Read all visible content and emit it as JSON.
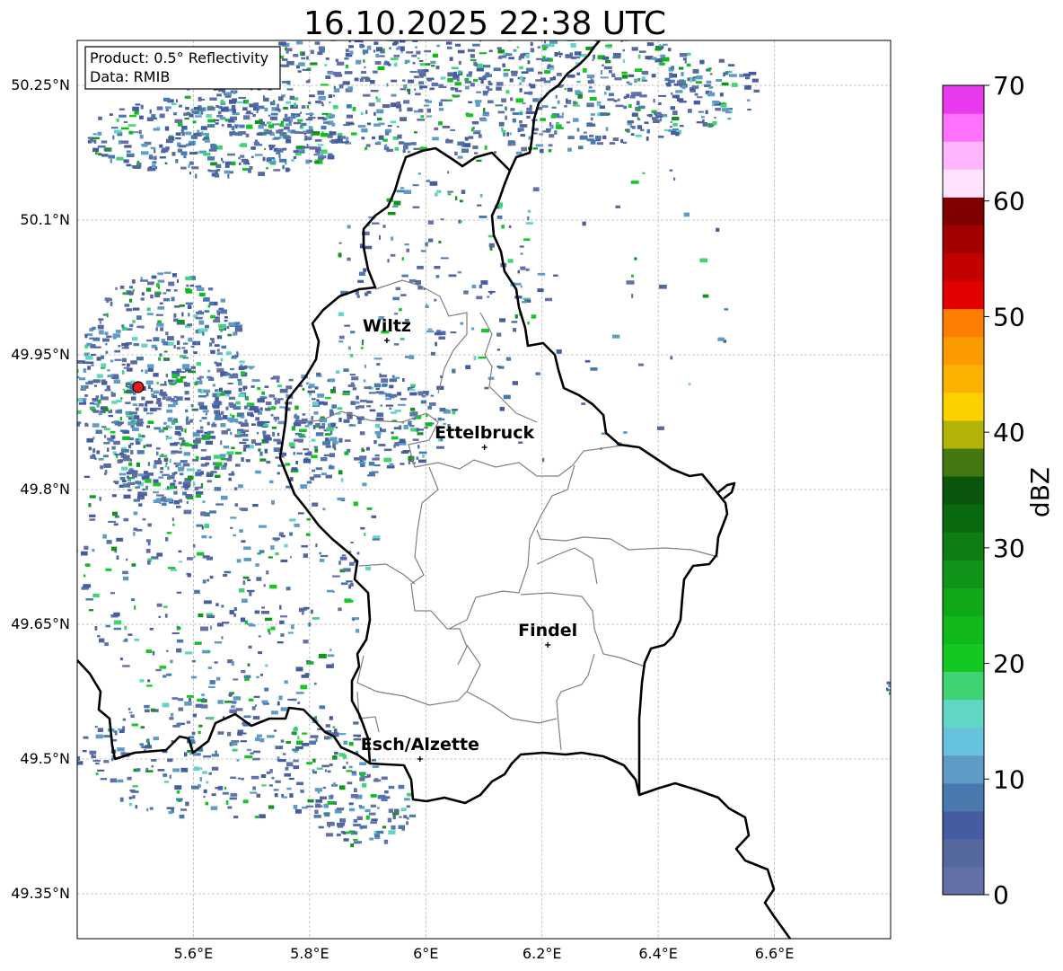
{
  "title": "16.10.2025 22:38 UTC",
  "info_box": {
    "product": "Product: 0.5° Reflectivity",
    "data": "Data: RMIB"
  },
  "map": {
    "lon_range": [
      5.4,
      6.8
    ],
    "lat_range": [
      49.3,
      50.3
    ],
    "lon_ticks": [
      {
        "value": 5.6,
        "label": "5.6°E"
      },
      {
        "value": 5.8,
        "label": "5.8°E"
      },
      {
        "value": 6.0,
        "label": "6°E"
      },
      {
        "value": 6.2,
        "label": "6.2°E"
      },
      {
        "value": 6.4,
        "label": "6.4°E"
      },
      {
        "value": 6.6,
        "label": "6.6°E"
      }
    ],
    "lat_ticks": [
      {
        "value": 50.25,
        "label": "50.25°N"
      },
      {
        "value": 50.1,
        "label": "50.1°N"
      },
      {
        "value": 49.95,
        "label": "49.95°N"
      },
      {
        "value": 49.8,
        "label": "49.8°N"
      },
      {
        "value": 49.65,
        "label": "49.65°N"
      },
      {
        "value": 49.5,
        "label": "49.5°N"
      },
      {
        "value": 49.35,
        "label": "49.35°N"
      }
    ],
    "cities": [
      {
        "name": "Wiltz",
        "lon": 5.933,
        "lat": 49.966
      },
      {
        "name": "Ettelbruck",
        "lon": 6.101,
        "lat": 49.847
      },
      {
        "name": "Findel",
        "lon": 6.21,
        "lat": 49.627
      },
      {
        "name": "Esch/Alzette",
        "lon": 5.99,
        "lat": 49.5
      }
    ],
    "radar_site": {
      "lon": 5.505,
      "lat": 49.914,
      "color": "#e8191a"
    }
  },
  "colorbar": {
    "label": "dBZ",
    "ticks": [
      0,
      10,
      20,
      30,
      40,
      50,
      60,
      70
    ],
    "colors": [
      "#6471a9",
      "#56699f",
      "#465ca2",
      "#4a79b0",
      "#5e9cc6",
      "#66c2dd",
      "#61d6c4",
      "#3fd373",
      "#13c921",
      "#12b91b",
      "#11a818",
      "#10941a",
      "#0e7e14",
      "#0a6a10",
      "#0b560d",
      "#437710",
      "#b1b407",
      "#fdd100",
      "#fcb200",
      "#fc9b00",
      "#fe7e03",
      "#e30100",
      "#c40000",
      "#a30000",
      "#7f0000",
      "#ffe2fe",
      "#ffb5fe",
      "#fe72fe",
      "#e939ec"
    ]
  }
}
